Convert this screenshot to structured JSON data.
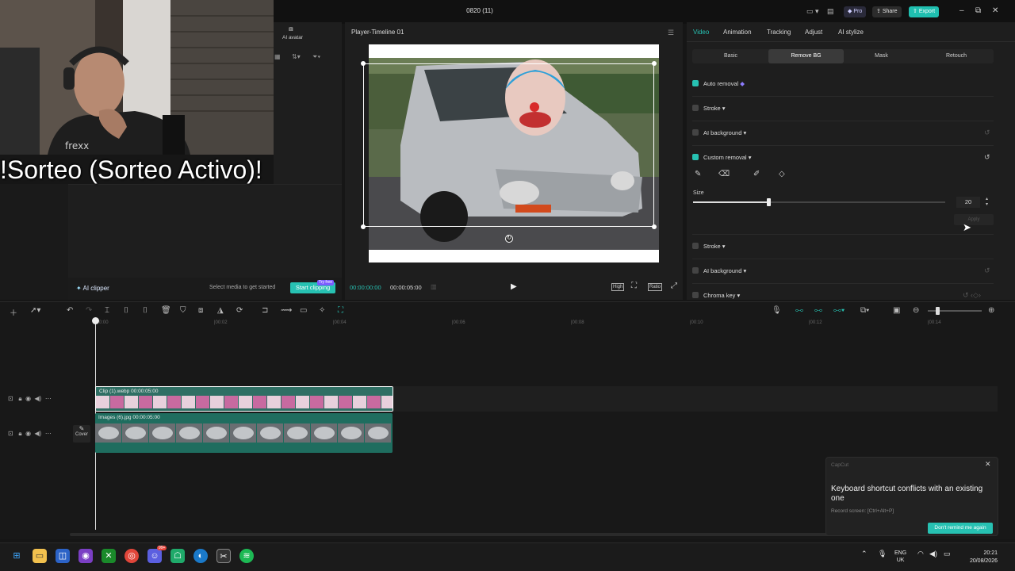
{
  "window": {
    "title": "0820 (11)",
    "pro_label": "Pro",
    "share_label": "Share",
    "export_label": "Export"
  },
  "overlay": {
    "raffle_text": "!Sorteo (Sorteo Activo)!"
  },
  "media_panel": {
    "ai_avatar_label": "AI avatar",
    "ai_clipper_label": "AI clipper",
    "hint": "Select media to get started",
    "start_clipping": "Start clipping",
    "try_free": "Try free"
  },
  "player": {
    "title": "Player-Timeline 01",
    "current_time": "00:00:00:00",
    "duration": "00:00:05:00",
    "quality_label": "High",
    "ratio_label": "Ratio"
  },
  "inspector": {
    "tabs": [
      "Video",
      "Animation",
      "Tracking",
      "Adjust",
      "AI stylize"
    ],
    "subtabs": [
      "Basic",
      "Remove BG",
      "Mask",
      "Retouch"
    ],
    "auto_removal": "Auto removal",
    "stroke": "Stroke",
    "ai_background": "AI background",
    "custom_removal": "Custom removal",
    "size_label": "Size",
    "size_value": "20",
    "size_level": 0.3,
    "apply_label": "Apply",
    "stroke2": "Stroke",
    "ai_background2": "AI background",
    "chroma_key": "Chroma key"
  },
  "timeline": {
    "ruler_marks": [
      "00:00",
      "00:02",
      "00:04",
      "00:06",
      "00:08",
      "00:10",
      "00:12",
      "00:14"
    ],
    "clip1_label": "Clip (1).webp   00:00:05:00",
    "clip2_label": "Images (6).jpg   00:00:05:00",
    "cover_label": "Cover"
  },
  "notification": {
    "app": "CapCut",
    "message": "Keyboard shortcut conflicts with an existing one",
    "detail": "Record screen: [Ctrl+Alt+P]",
    "dismiss": "Don't remind me again"
  },
  "taskbar": {
    "lang_top": "ENG",
    "lang_bottom": "UK",
    "time": "20:21",
    "date": "20/08/2026",
    "chat_badge": "99+"
  }
}
